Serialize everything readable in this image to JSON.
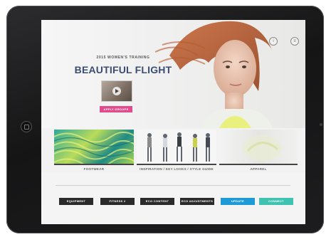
{
  "hero": {
    "kicker": "2015 WOMEN'S TRAINING",
    "title": "BEAUTIFUL FLIGHT",
    "cta_label": "APPLY GROUPS",
    "info_label": "i",
    "menu_label": "≡"
  },
  "tiles": [
    {
      "label": "FOOTWEAR"
    },
    {
      "label": "INSPIRATION / KEY LOOKS / STYLE GUIDE"
    },
    {
      "label": "APPAREL"
    }
  ],
  "bottom_buttons": [
    {
      "label": "EQUIPMENT"
    },
    {
      "label": "FITNESS 2"
    },
    {
      "label": "ECO CONTENT"
    },
    {
      "label": "ECO ADJUSTMENTS"
    },
    {
      "label": "UPDATE"
    },
    {
      "label": "CONNECT"
    }
  ],
  "colors": {
    "title": "#3b4d70",
    "cta": "#e24b8c",
    "blue_button": "#1e9ad6",
    "teal_button": "#3fc2b0"
  }
}
